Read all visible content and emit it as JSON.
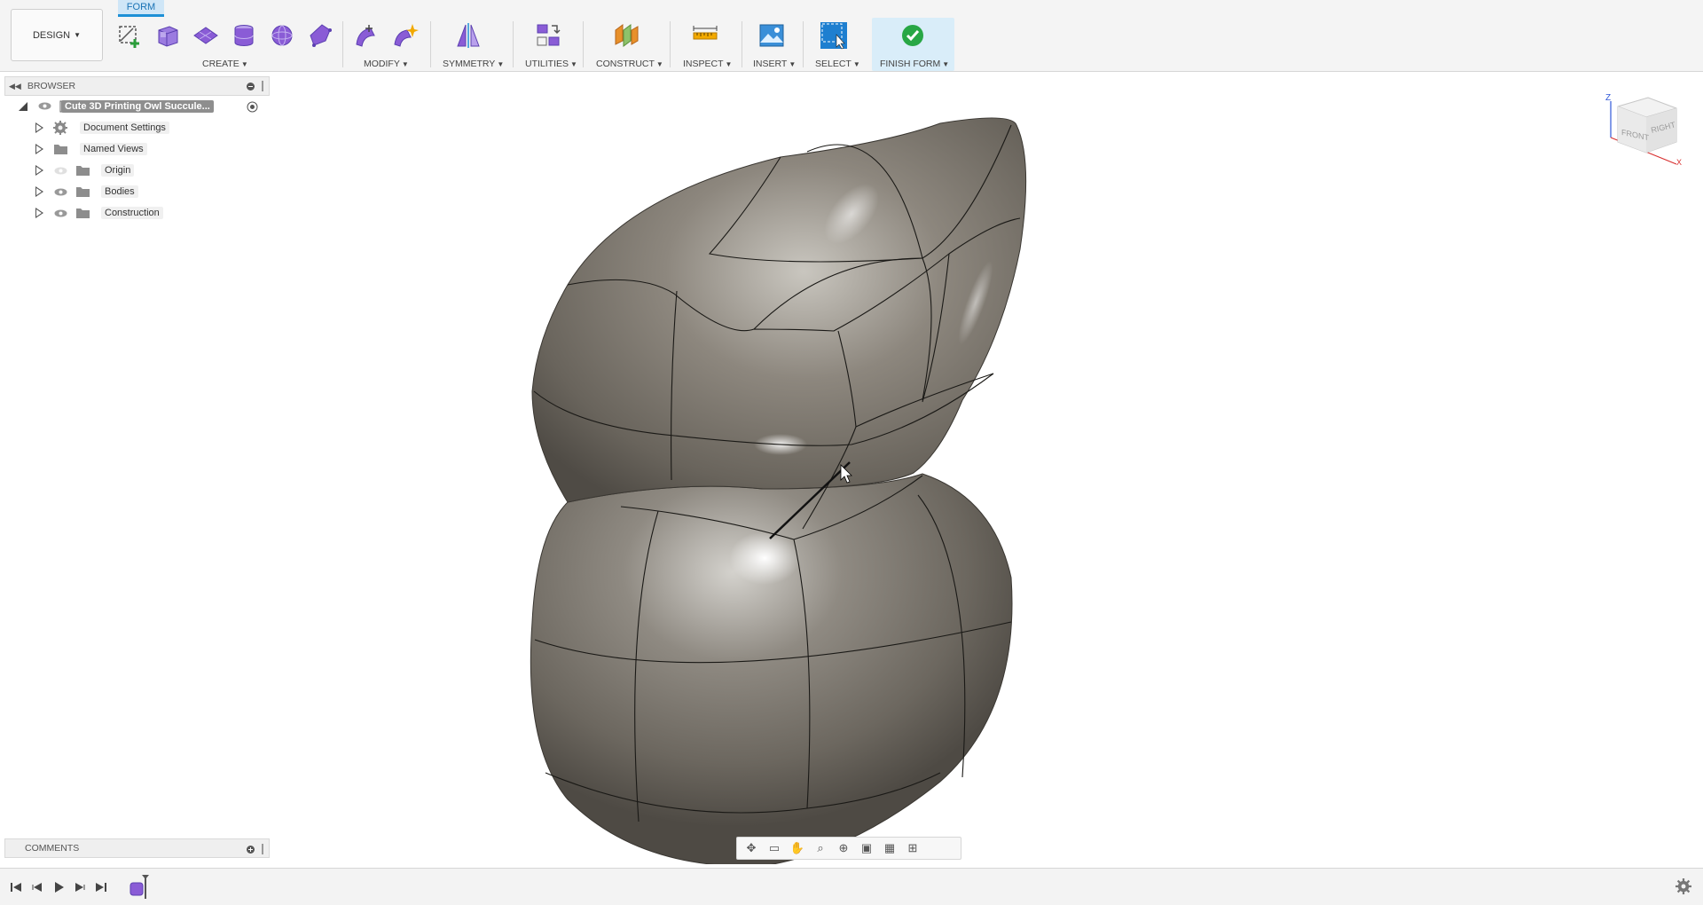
{
  "toolbar": {
    "workspace_label": "DESIGN",
    "active_tab": "FORM",
    "groups": {
      "create": "CREATE",
      "modify": "MODIFY",
      "symmetry": "SYMMETRY",
      "utilities": "UTILITIES",
      "construct": "CONSTRUCT",
      "inspect": "INSPECT",
      "insert": "INSERT",
      "select": "SELECT",
      "finish": "FINISH FORM"
    }
  },
  "browser": {
    "title": "BROWSER",
    "root": "Cute 3D Printing Owl Succule...",
    "items": [
      {
        "label": "Document Settings",
        "icon": "gear-icon"
      },
      {
        "label": "Named Views",
        "icon": "folder-icon"
      },
      {
        "label": "Origin",
        "icon": "folder-icon"
      },
      {
        "label": "Bodies",
        "icon": "folder-icon"
      },
      {
        "label": "Construction",
        "icon": "folder-icon"
      }
    ]
  },
  "comments": {
    "title": "COMMENTS"
  },
  "viewcube": {
    "front": "FRONT",
    "right": "RIGHT",
    "axis_z": "Z",
    "axis_x": "X"
  },
  "colors": {
    "accent": "#1e90d6",
    "create_icon": "#8a5cd6",
    "finish_green": "#28a745",
    "toolbar_bg": "#f4f4f4"
  }
}
